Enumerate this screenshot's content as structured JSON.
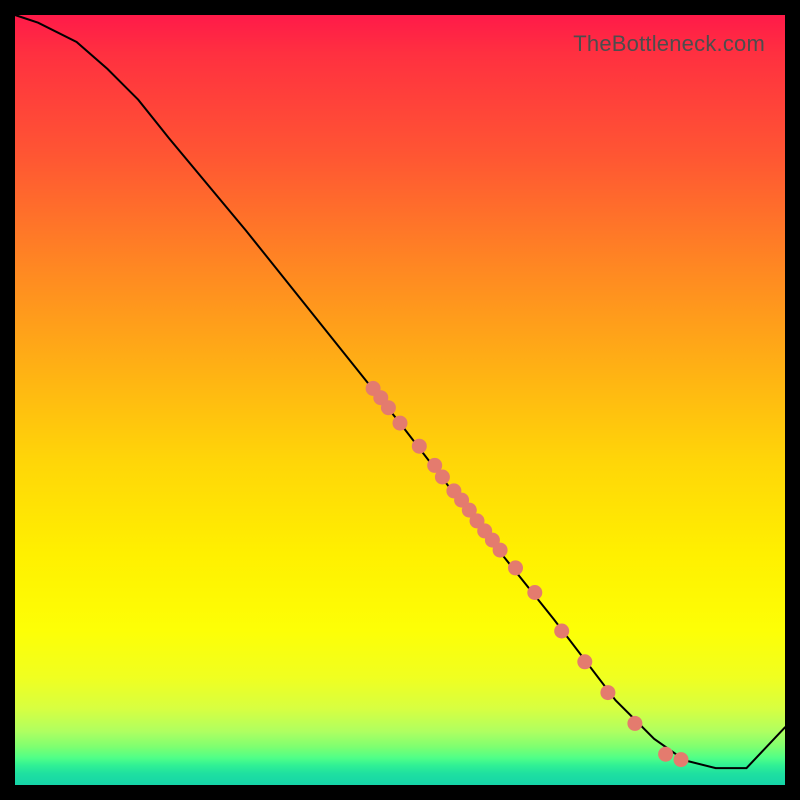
{
  "watermark": "TheBottleneck.com",
  "chart_data": {
    "type": "line",
    "title": "",
    "xlabel": "",
    "ylabel": "",
    "xlim": [
      0,
      100
    ],
    "ylim": [
      0,
      100
    ],
    "series": [
      {
        "name": "bottleneck-curve",
        "x": [
          0,
          3,
          8,
          12,
          16,
          20,
          30,
          40,
          50,
          60,
          70,
          78,
          83,
          87,
          91,
          95,
          100
        ],
        "y": [
          100,
          99,
          96.5,
          93,
          89,
          84,
          72,
          59.5,
          47,
          34,
          21.5,
          11,
          6,
          3.2,
          2.2,
          2.2,
          7.5
        ]
      }
    ],
    "scatter": {
      "name": "highlighted-points",
      "x": [
        46.5,
        47.5,
        48.5,
        50.0,
        52.5,
        54.5,
        55.5,
        57.0,
        58.0,
        59.0,
        60.0,
        61.0,
        62.0,
        63.0,
        65.0,
        67.5,
        71.0,
        74.0,
        77.0,
        80.5,
        84.5,
        86.5
      ],
      "y": [
        51.5,
        50.3,
        49.0,
        47.0,
        44.0,
        41.5,
        40.0,
        38.2,
        37.0,
        35.7,
        34.3,
        33.0,
        31.8,
        30.5,
        28.2,
        25.0,
        20.0,
        16.0,
        12.0,
        8.0,
        4.0,
        3.3
      ]
    },
    "colors": {
      "curve": "#000000",
      "points_fill": "#e47b6e",
      "points_stroke": "#d9584a"
    }
  }
}
